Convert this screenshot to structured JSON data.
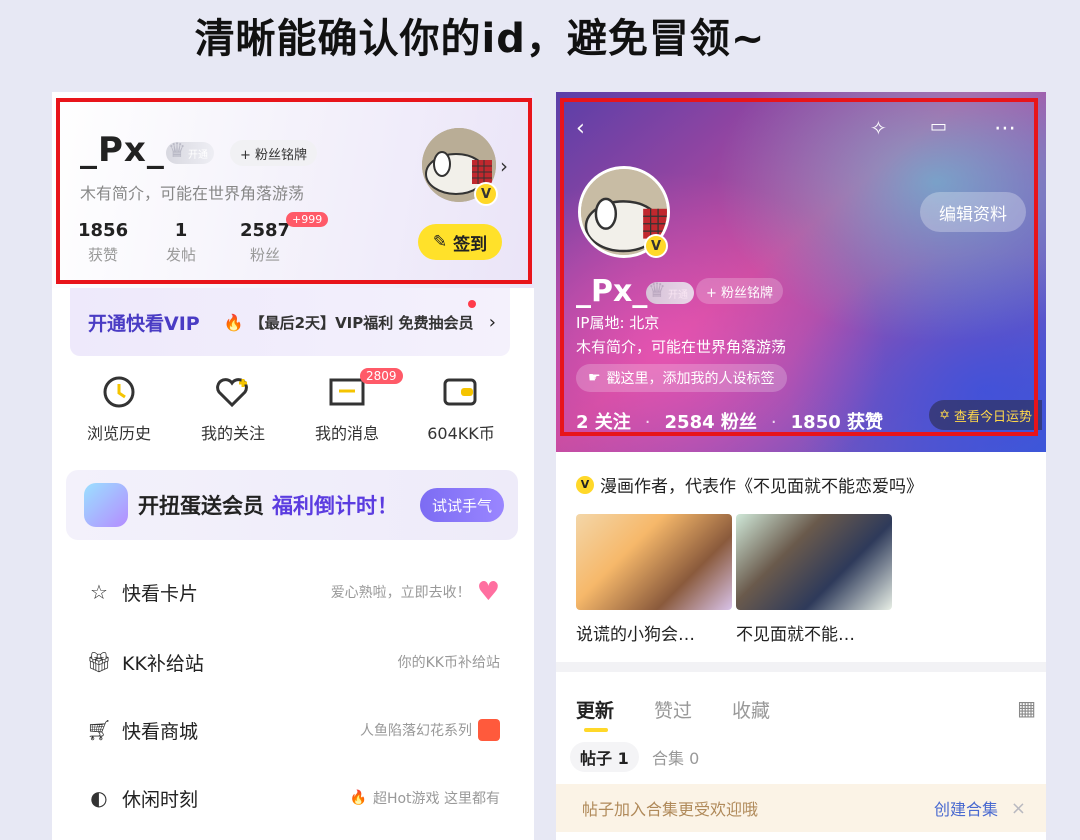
{
  "caption": "清晰能确认你的id，避免冒领~",
  "left": {
    "username": "_Px_",
    "crown_badge": "开通",
    "fan_badge": "+ 粉丝铭牌",
    "bio": "木有简介，可能在世界角落游荡",
    "stats": [
      {
        "value": "1856",
        "label": "获赞"
      },
      {
        "value": "1",
        "label": "发帖"
      },
      {
        "value": "2587",
        "label": "粉丝"
      }
    ],
    "fans_badge": "+999",
    "sign_button": "签到",
    "avatar_badge": "V",
    "vip": {
      "title": "开通快看VIP",
      "message": "【最后2天】VIP福利 免费抽会员",
      "arrow": "›"
    },
    "shortcuts": [
      {
        "icon": "clock-icon",
        "label": "浏览历史"
      },
      {
        "icon": "heart-plus-icon",
        "label": "我的关注"
      },
      {
        "icon": "mail-icon",
        "label": "我的消息",
        "badge": "2809"
      },
      {
        "icon": "wallet-icon",
        "label": "604KK币"
      }
    ],
    "gacha": {
      "title": "开扭蛋送会员",
      "highlight": "福利倒计时！",
      "button": "试试手气"
    },
    "menu": [
      {
        "icon": "card-icon",
        "label": "快看卡片",
        "hint": "爱心熟啦，立即去收！"
      },
      {
        "icon": "gift-box-icon",
        "label": "KK补给站",
        "hint": "你的KK币补给站"
      },
      {
        "icon": "cart-icon",
        "label": "快看商城",
        "hint": "人鱼陷落幻花系列"
      },
      {
        "icon": "gamepad-icon",
        "label": "休闲时刻",
        "hint": "超Hot游戏 这里都有"
      }
    ]
  },
  "right": {
    "edit_button": "编辑资料",
    "username": "_Px_",
    "crown_badge": "开通",
    "fan_badge": "+ 粉丝铭牌",
    "ip": "IP属地: 北京",
    "bio": "木有简介，可能在世界角落游荡",
    "tag_prompt": "戳这里，添加我的人设标签",
    "stats": {
      "follow": "2 关注",
      "fans": "2584 粉丝",
      "likes": "1850 获赞"
    },
    "luck": "查看今日运势",
    "author_line": "漫画作者，代表作《不见面就不能恋爱吗》",
    "works": [
      {
        "title": "说谎的小狗会…"
      },
      {
        "title": "不见面就不能…"
      }
    ],
    "tabs": [
      "更新",
      "赞过",
      "收藏"
    ],
    "subtabs": {
      "posts": "帖子 1",
      "collections": "合集 0"
    },
    "tip": {
      "text": "帖子加入合集更受欢迎哦",
      "action": "创建合集",
      "close": "×"
    }
  },
  "colors": {
    "accent_yellow": "#ffd829",
    "vip_purple": "#4a3cc4",
    "highlight_red": "#e8141a"
  }
}
